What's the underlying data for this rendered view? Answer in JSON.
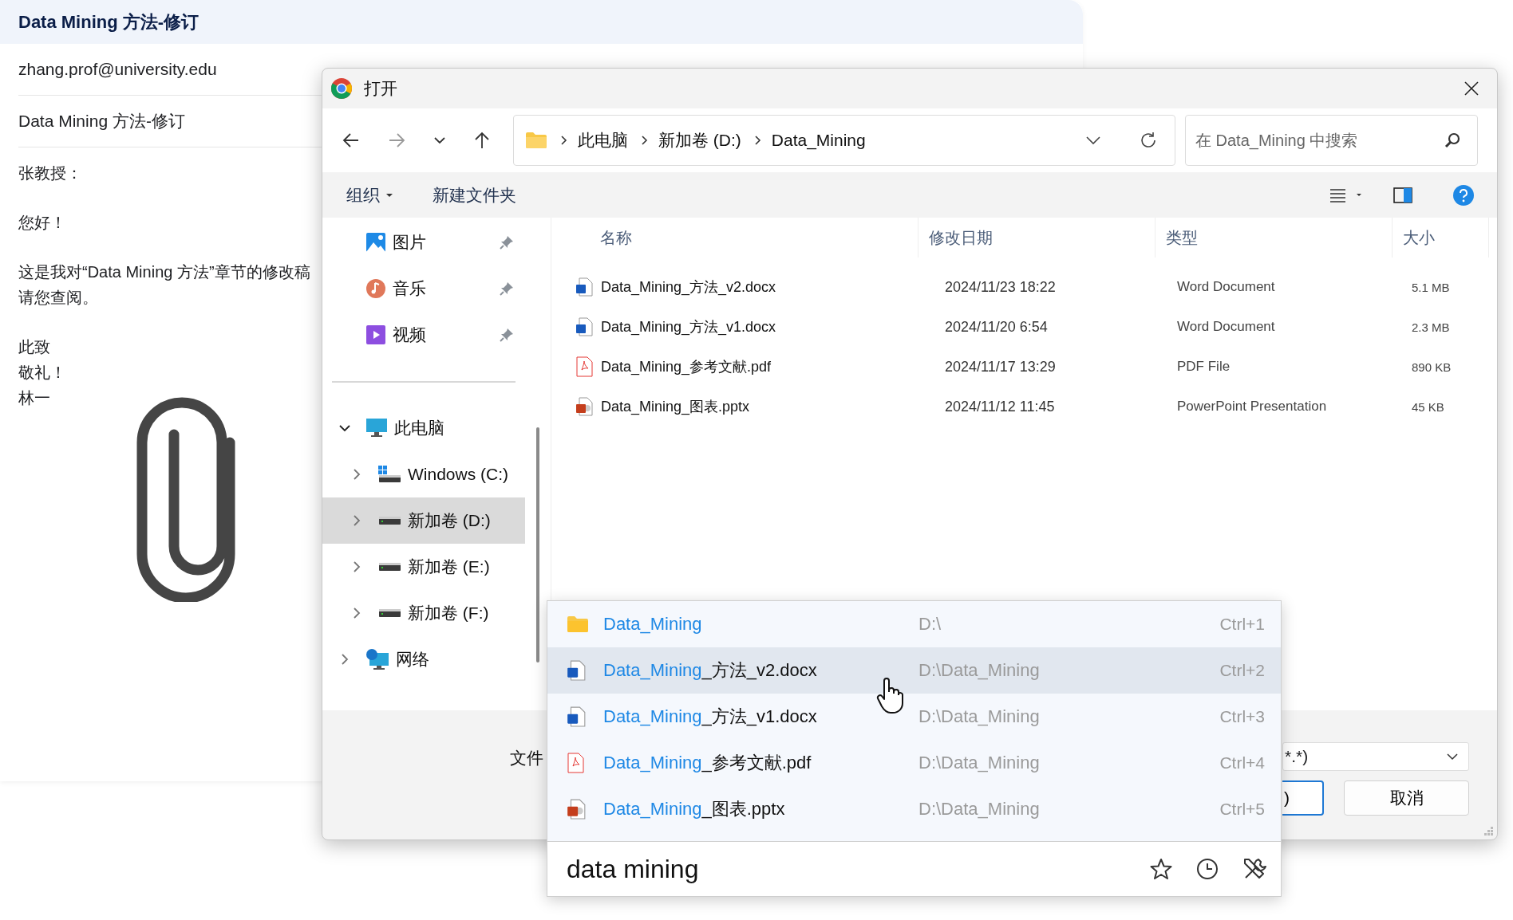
{
  "email": {
    "header_title": "Data Mining 方法-修订",
    "to": "zhang.prof@university.edu",
    "subject": "Data Mining 方法-修订",
    "body": [
      [
        "张教授："
      ],
      [
        "您好！"
      ],
      [
        "这是我对“Data Mining 方法”章节的修改稿",
        "请您查阅。"
      ],
      [
        "此致",
        "敬礼！",
        "林一"
      ]
    ]
  },
  "dialog": {
    "title": "打开",
    "breadcrumb": [
      "此电脑",
      "新加卷 (D:)",
      "Data_Mining"
    ],
    "search": {
      "placeholder": "在 Data_Mining 中搜索"
    },
    "toolbar": {
      "organize": "组织",
      "new_folder": "新建文件夹"
    },
    "nav": [
      {
        "label": "图片",
        "kind": "pictures",
        "pinned": true,
        "selected": false
      },
      {
        "label": "音乐",
        "kind": "music",
        "pinned": true,
        "selected": false
      },
      {
        "label": "视频",
        "kind": "videos",
        "pinned": true,
        "selected": false
      }
    ],
    "tree": [
      {
        "label": "此电脑",
        "kind": "pc",
        "expanded": true,
        "selected": false,
        "children": [
          {
            "label": "Windows (C:)",
            "kind": "windows-drive",
            "expanded": false,
            "selected": false
          },
          {
            "label": "新加卷 (D:)",
            "kind": "drive",
            "expanded": false,
            "selected": true
          },
          {
            "label": "新加卷 (E:)",
            "kind": "drive",
            "expanded": false,
            "selected": false
          },
          {
            "label": "新加卷 (F:)",
            "kind": "drive",
            "expanded": false,
            "selected": false
          }
        ]
      },
      {
        "label": "网络",
        "kind": "network",
        "expanded": false,
        "selected": false
      }
    ],
    "columns": [
      "名称",
      "修改日期",
      "类型",
      "大小"
    ],
    "files": [
      {
        "name": "Data_Mining_方法_v2.docx",
        "kind": "docx",
        "date": "2024/11/23 18:22",
        "type": "Word Document",
        "size": "5.1 MB"
      },
      {
        "name": "Data_Mining_方法_v1.docx",
        "kind": "docx",
        "date": "2024/11/20 6:54",
        "type": "Word Document",
        "size": "2.3 MB"
      },
      {
        "name": "Data_Mining_参考文献.pdf",
        "kind": "pdf",
        "date": "2024/11/17 13:29",
        "type": "PDF File",
        "size": "890 KB"
      },
      {
        "name": "Data_Mining_图表.pptx",
        "kind": "pptx",
        "date": "2024/11/12 11:45",
        "type": "PowerPoint Presentation",
        "size": "45 KB"
      }
    ],
    "filename_label": "文件",
    "filetype": "*.*)",
    "open_button": ")",
    "cancel_button": "取消"
  },
  "popup": {
    "results": [
      {
        "match": "Data_Mining",
        "kind": "folder",
        "path": "D:\\",
        "shortcut": "Ctrl+1",
        "selected": false
      },
      {
        "match": "Data_Mining",
        "rest": "_方法_v2.docx",
        "kind": "docx",
        "path": "D:\\Data_Mining",
        "shortcut": "Ctrl+2",
        "selected": true
      },
      {
        "match": "Data_Mining",
        "rest": "_方法_v1.docx",
        "kind": "docx",
        "path": "D:\\Data_Mining",
        "shortcut": "Ctrl+3",
        "selected": false
      },
      {
        "match": "Data_Mining",
        "rest": "_参考文献.pdf",
        "kind": "pdf",
        "path": "D:\\Data_Mining",
        "shortcut": "Ctrl+4",
        "selected": false
      },
      {
        "match": "Data_Mining",
        "rest": "_图表.pptx",
        "kind": "pptx",
        "path": "D:\\Data_Mining",
        "shortcut": "Ctrl+5",
        "selected": false
      }
    ],
    "query": "data mining"
  }
}
